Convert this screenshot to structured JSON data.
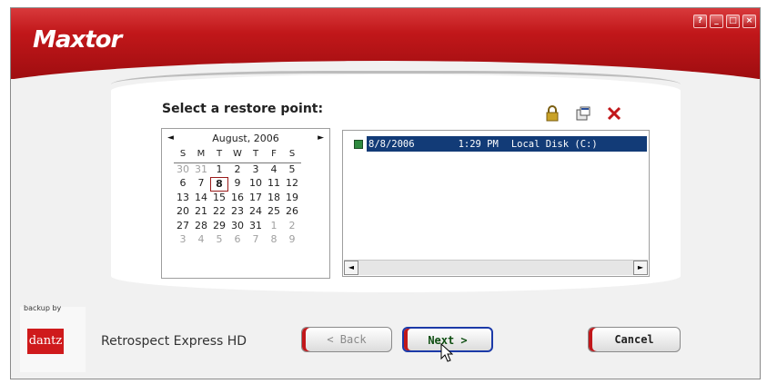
{
  "window": {
    "logo": "Maxtor",
    "controls": [
      "?",
      "_",
      "□",
      "×"
    ]
  },
  "main": {
    "heading": "Select a restore point:",
    "tool_icons": [
      "lock-icon",
      "properties-icon",
      "delete-icon"
    ]
  },
  "calendar": {
    "month_label": "August, 2006",
    "prev_arrow": "◄",
    "next_arrow": "►",
    "days_of_week": [
      "S",
      "M",
      "T",
      "W",
      "T",
      "F",
      "S"
    ],
    "weeks": [
      [
        "30",
        "31",
        "1",
        "2",
        "3",
        "4",
        "5"
      ],
      [
        "6",
        "7",
        "8",
        "9",
        "10",
        "11",
        "12"
      ],
      [
        "13",
        "14",
        "15",
        "16",
        "17",
        "18",
        "19"
      ],
      [
        "20",
        "21",
        "22",
        "23",
        "24",
        "25",
        "26"
      ],
      [
        "27",
        "28",
        "29",
        "30",
        "31",
        "1",
        "2"
      ],
      [
        "3",
        "4",
        "5",
        "6",
        "7",
        "8",
        "9"
      ]
    ],
    "selected_day": "8"
  },
  "restore_points": [
    {
      "date": "8/8/2006",
      "time": "1:29 PM",
      "location": "Local Disk (C:)"
    }
  ],
  "scrollbar": {
    "left": "◄",
    "right": "►"
  },
  "branding": {
    "backup_by": "backup by",
    "company": "dantz",
    "product": "Retrospect Express HD"
  },
  "buttons": {
    "back": "< Back",
    "next": "Next >",
    "cancel": "Cancel"
  },
  "colors": {
    "brand_red": "#c1171a",
    "selection_blue": "#123b77"
  }
}
